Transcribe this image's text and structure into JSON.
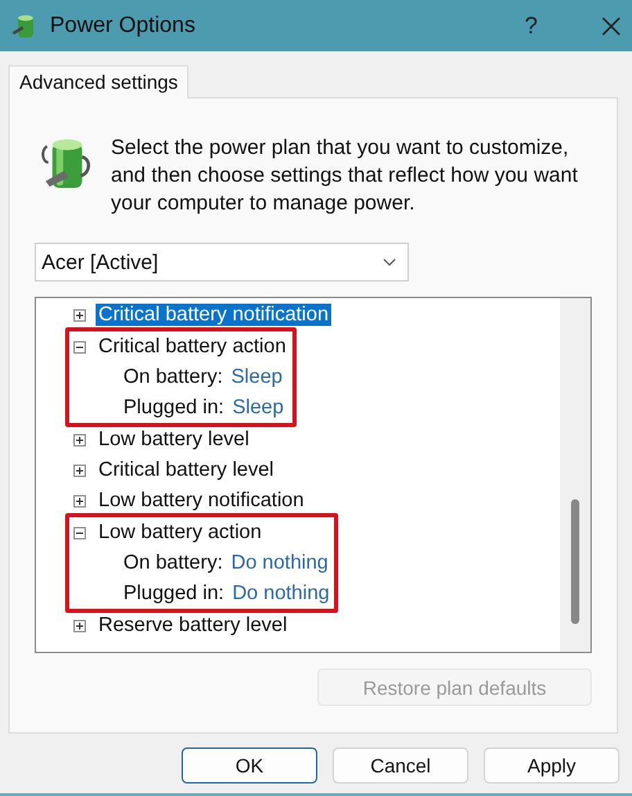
{
  "window": {
    "title": "Power Options",
    "help": "?"
  },
  "tabs": [
    {
      "label": "Advanced settings",
      "selected": true
    }
  ],
  "intro": "Select the power plan that you want to customize, and then choose settings that reflect how you want your computer to manage power.",
  "plan_select": {
    "value": "Acer [Active]"
  },
  "tree": [
    {
      "label": "Critical battery notification",
      "expanded": false,
      "selected": true,
      "highlighted": false
    },
    {
      "label": "Critical battery action",
      "expanded": true,
      "selected": false,
      "highlighted": true,
      "children": [
        {
          "label": "On battery:",
          "value": "Sleep"
        },
        {
          "label": "Plugged in:",
          "value": "Sleep"
        }
      ]
    },
    {
      "label": "Low battery level",
      "expanded": false,
      "selected": false,
      "highlighted": false
    },
    {
      "label": "Critical battery level",
      "expanded": false,
      "selected": false,
      "highlighted": false
    },
    {
      "label": "Low battery notification",
      "expanded": false,
      "selected": false,
      "highlighted": false
    },
    {
      "label": "Low battery action",
      "expanded": true,
      "selected": false,
      "highlighted": true,
      "children": [
        {
          "label": "On battery:",
          "value": "Do nothing"
        },
        {
          "label": "Plugged in:",
          "value": "Do nothing"
        }
      ]
    },
    {
      "label": "Reserve battery level",
      "expanded": false,
      "selected": false,
      "highlighted": false
    }
  ],
  "restore_button": {
    "label": "Restore plan defaults",
    "disabled": true
  },
  "buttons": [
    {
      "label": "OK",
      "default": true
    },
    {
      "label": "Cancel",
      "default": false
    },
    {
      "label": "Apply",
      "default": false
    }
  ]
}
